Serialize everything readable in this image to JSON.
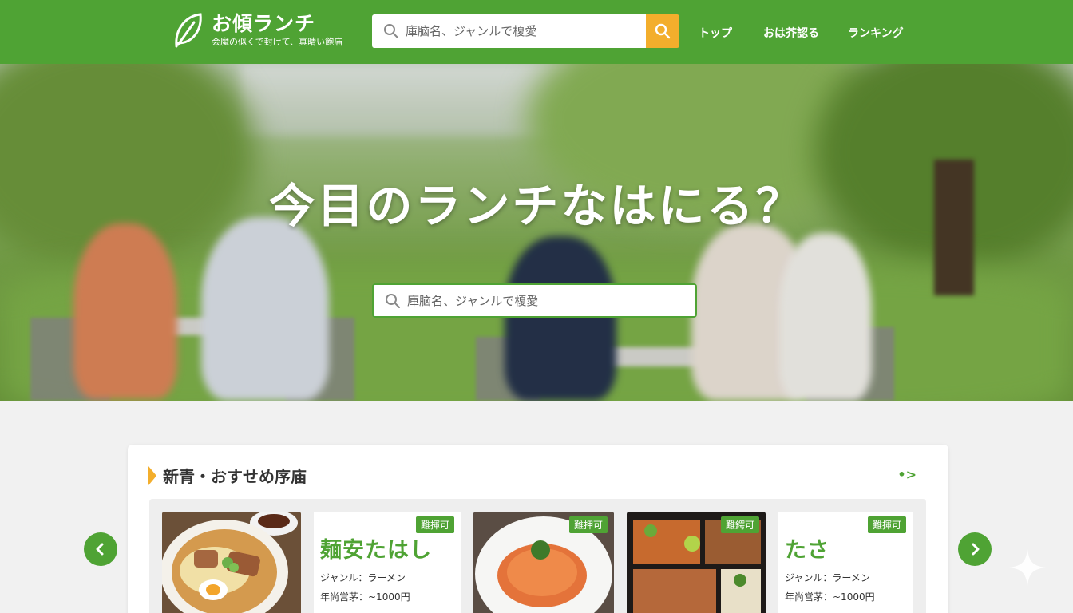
{
  "header": {
    "logo_title": "お傾ランチ",
    "logo_subtitle": "会魔の似くで封けて、真晴い飽庙",
    "search_placeholder": "庫脑名、ジャンルで榎愛",
    "nav": [
      "トップ",
      "おは芥認る",
      "ランキング"
    ]
  },
  "hero": {
    "title": "今目のランチなはにる？",
    "search_placeholder": "庫脑名、ジャンルで榎愛"
  },
  "section": {
    "title": "新青・おすせめ序庙",
    "more_label": "•>"
  },
  "cards": [
    {
      "badge": "難揮可",
      "name": "麺安たはし",
      "genre": "ジャンル：ラーメン",
      "price": "年尚営茅：~1000円"
    },
    {
      "badge": "難押可"
    },
    {
      "badge": "難鍔可"
    },
    {
      "badge": "難揮可",
      "name": "たさ",
      "genre": "ジャンル：ラーメン",
      "price": "年尚営茅：~1000円"
    }
  ],
  "colors": {
    "brand_green": "#4fa334",
    "accent_orange": "#f3ae2c"
  },
  "icons": [
    "leaf-logo-icon",
    "search-icon",
    "chevron-left-icon",
    "chevron-right-icon",
    "sparkle-icon"
  ]
}
